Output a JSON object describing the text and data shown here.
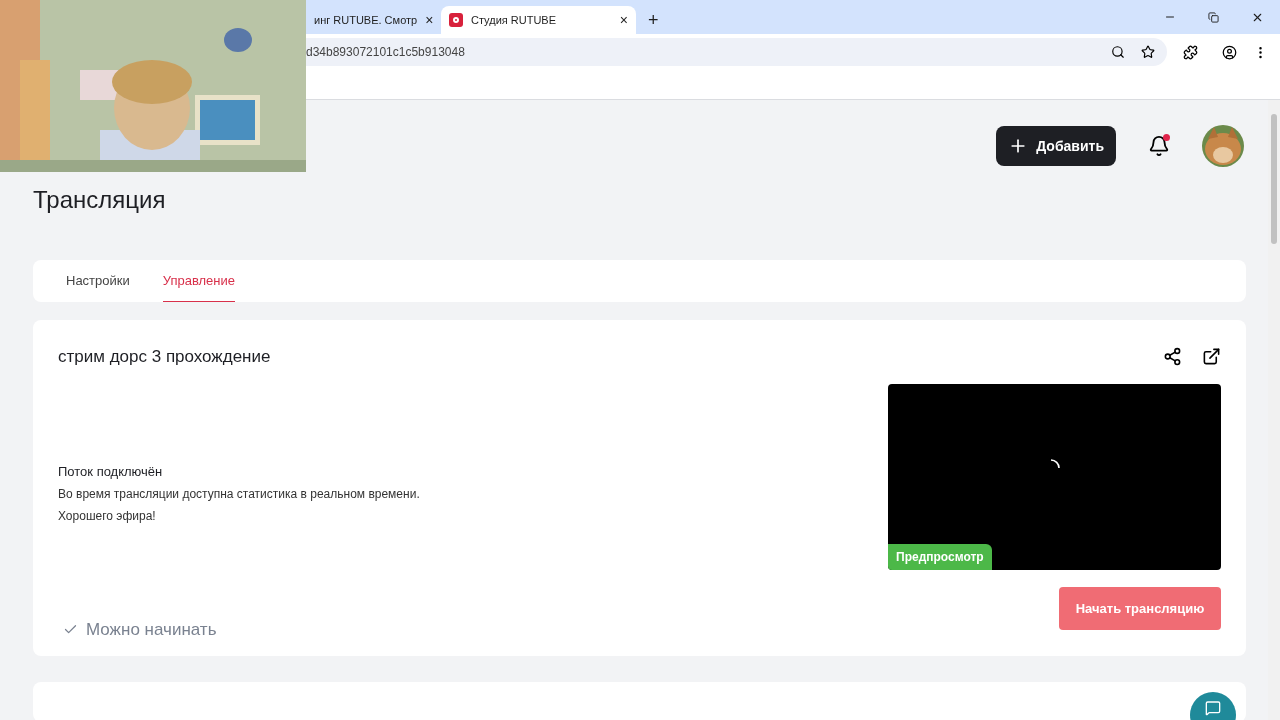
{
  "browser": {
    "tabs": [
      {
        "title": "инг RUTUBE. Смотр",
        "close": "×",
        "selected": false
      },
      {
        "title": "Студия RUTUBE",
        "close": "×",
        "selected": true
      }
    ],
    "new_tab": "+",
    "url": "d34b893072101c1c5b913048"
  },
  "header": {
    "add_button": "Добавить",
    "notification_dot": true
  },
  "page_title": "Трансляция",
  "tabs": [
    {
      "label": "Настройки",
      "selected": false
    },
    {
      "label": "Управление",
      "selected": true
    }
  ],
  "stream": {
    "title": "стрим дорс 3 прохождение",
    "status_title": "Поток подключён",
    "status_text": "Во время трансляции доступна статистика в реальном времени.",
    "wish": "Хорошего эфира!",
    "ready": "Можно начинать",
    "preview_label": "Предпросмотр",
    "start_button": "Начать трансляцию"
  }
}
